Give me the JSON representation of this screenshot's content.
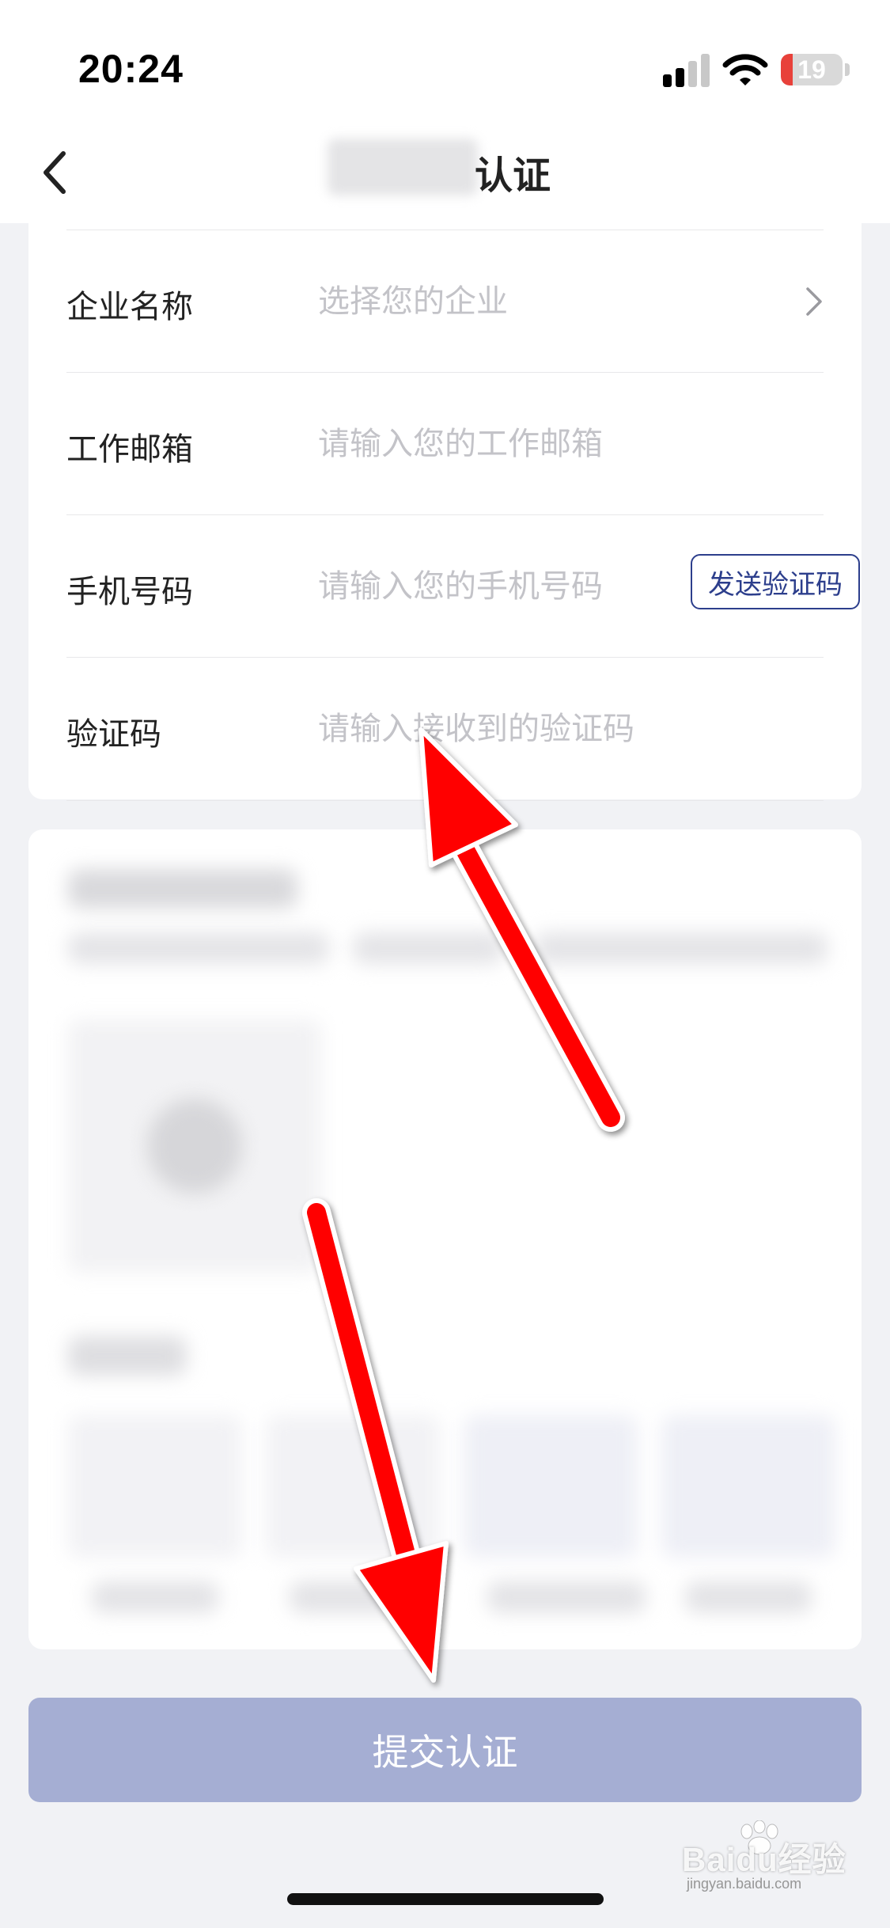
{
  "status_bar": {
    "time": "20:24",
    "battery_percent": "19",
    "battery_level": 0.19,
    "battery_color": "#e8413a",
    "icons": [
      "signal-icon",
      "wifi-icon",
      "battery-icon"
    ]
  },
  "nav": {
    "title_visible": "认证",
    "back_icon": "chevron-left-icon"
  },
  "form": {
    "rows": [
      {
        "label": "企业名称",
        "placeholder": "选择您的企业",
        "icon": "chevron-right-icon"
      },
      {
        "label": "工作邮箱",
        "placeholder": "请输入您的工作邮箱"
      },
      {
        "label": "手机号码",
        "placeholder": "请输入您的手机号码",
        "button": "发送验证码"
      },
      {
        "label": "验证码",
        "placeholder": "请输入接收到的验证码"
      }
    ]
  },
  "submit_label": "提交认证",
  "watermark": {
    "text": "Baidu经验",
    "sub": "jingyan.baidu.com"
  },
  "colors": {
    "accent": "#2c3e8c",
    "submit_bg": "#a5aed3",
    "arrow": "#ff0000",
    "background": "#f1f2f5"
  }
}
